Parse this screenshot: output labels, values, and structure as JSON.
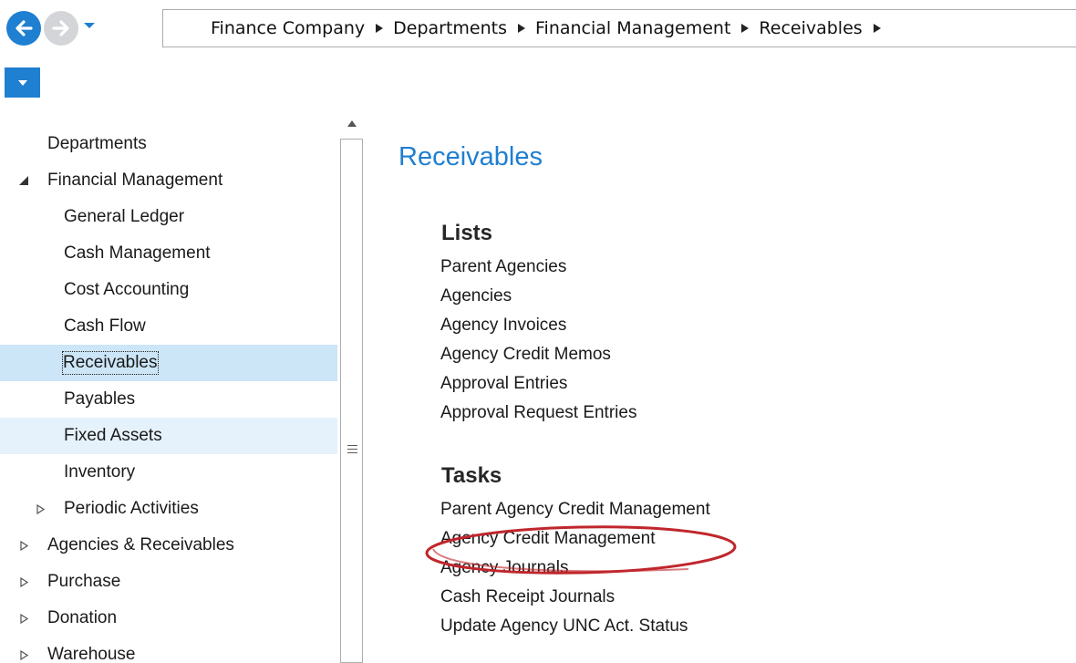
{
  "navigation": {
    "back_icon": "arrow-left-icon",
    "forward_icon": "arrow-right-icon",
    "history_dropdown_icon": "chevron-down-icon",
    "menu_dropdown_icon": "chevron-down-icon",
    "accent_color": "#1f7fd0"
  },
  "breadcrumb": {
    "items": [
      "Finance Company",
      "Departments",
      "Financial Management",
      "Receivables"
    ],
    "separator_icon": "triangle-right-icon"
  },
  "nav_tree": {
    "items": [
      {
        "label": "Departments",
        "level": 0,
        "arrow": "none"
      },
      {
        "label": "Financial Management",
        "level": 0,
        "arrow": "expanded"
      },
      {
        "label": "General Ledger",
        "level": 1,
        "arrow": "none"
      },
      {
        "label": "Cash Management",
        "level": 1,
        "arrow": "none"
      },
      {
        "label": "Cost Accounting",
        "level": 1,
        "arrow": "none"
      },
      {
        "label": "Cash Flow",
        "level": 1,
        "arrow": "none"
      },
      {
        "label": "Receivables",
        "level": 1,
        "arrow": "none",
        "state": "selected"
      },
      {
        "label": "Payables",
        "level": 1,
        "arrow": "none"
      },
      {
        "label": "Fixed Assets",
        "level": 1,
        "arrow": "none",
        "state": "hover"
      },
      {
        "label": "Inventory",
        "level": 1,
        "arrow": "none"
      },
      {
        "label": "Periodic Activities",
        "level": 1,
        "arrow": "collapsed"
      },
      {
        "label": "Agencies & Receivables",
        "level": 0,
        "arrow": "collapsed"
      },
      {
        "label": "Purchase",
        "level": 0,
        "arrow": "collapsed"
      },
      {
        "label": "Donation",
        "level": 0,
        "arrow": "collapsed"
      },
      {
        "label": "Warehouse",
        "level": 0,
        "arrow": "collapsed"
      }
    ],
    "selected_color": "#cce5f7",
    "hover_color": "#e6f2fb"
  },
  "content": {
    "title": "Receivables",
    "sections": [
      {
        "heading": "Lists",
        "links": [
          "Parent Agencies",
          "Agencies",
          "Agency Invoices",
          "Agency Credit Memos",
          "Approval Entries",
          "Approval Request Entries"
        ]
      },
      {
        "heading": "Tasks",
        "links": [
          "Parent Agency Credit Management",
          "Agency Credit Management",
          "Agency Journals",
          "Cash Receipt Journals",
          "Update Agency UNC Act. Status"
        ]
      }
    ],
    "highlighted_link": "Agency Credit Management",
    "highlight_color": "#c0262c"
  }
}
